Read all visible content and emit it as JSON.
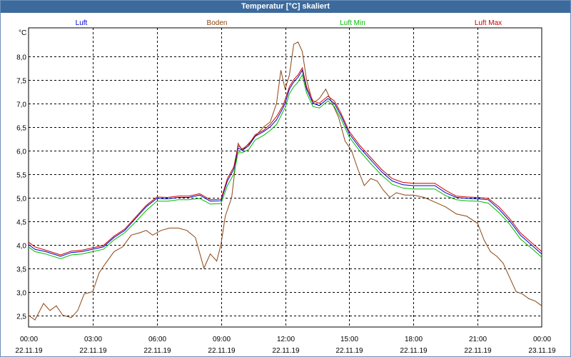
{
  "window": {
    "title": "Temperatur [°C] skaliert"
  },
  "chart_data": {
    "type": "line",
    "title": "Temperatur [°C] skaliert",
    "ylabel": "°C",
    "ylim": [
      2.25,
      8.6
    ],
    "xlim": [
      0,
      24
    ],
    "grid": true,
    "legend_position": "top",
    "y_ticks": [
      2.5,
      3.0,
      3.5,
      4.0,
      4.5,
      5.0,
      5.5,
      6.0,
      6.5,
      7.0,
      7.5,
      8.0
    ],
    "y_tick_labels": [
      "2,5",
      "3,0",
      "3,5",
      "4,0",
      "4,5",
      "5,0",
      "5,5",
      "6,0",
      "6,5",
      "7,0",
      "7,5",
      "8,0"
    ],
    "x_ticks": [
      {
        "x": 0,
        "time": "00:00",
        "date": "22.11.19"
      },
      {
        "x": 3,
        "time": "03:00",
        "date": "22.11.19"
      },
      {
        "x": 6,
        "time": "06:00",
        "date": "22.11.19"
      },
      {
        "x": 9,
        "time": "09:00",
        "date": "22.11.19"
      },
      {
        "x": 12,
        "time": "12:00",
        "date": "22.11.19"
      },
      {
        "x": 15,
        "time": "15:00",
        "date": "22.11.19"
      },
      {
        "x": 18,
        "time": "18:00",
        "date": "22.11.19"
      },
      {
        "x": 21,
        "time": "21:00",
        "date": "22.11.19"
      },
      {
        "x": 24,
        "time": "00:00",
        "date": "23.11.19"
      }
    ],
    "series": [
      {
        "name": "Luft",
        "color": "#0000cc",
        "x": [
          0,
          0.3,
          0.8,
          1.5,
          2,
          2.5,
          3,
          3.5,
          4,
          4.5,
          5,
          5.5,
          6,
          6.5,
          7,
          7.5,
          8,
          8.5,
          9,
          9.3,
          9.6,
          9.8,
          10,
          10.3,
          10.6,
          11,
          11.3,
          11.6,
          11.9,
          12,
          12.2,
          12.4,
          12.6,
          12.8,
          13,
          13.3,
          13.6,
          14,
          14.3,
          14.6,
          15,
          15.5,
          16,
          16.5,
          17,
          17.5,
          18,
          18.5,
          19,
          19.5,
          20,
          20.5,
          21,
          21.5,
          22,
          22.5,
          23,
          23.5,
          24
        ],
        "y": [
          4.0,
          3.9,
          3.85,
          3.75,
          3.83,
          3.85,
          3.9,
          3.95,
          4.15,
          4.3,
          4.55,
          4.8,
          4.98,
          4.97,
          5.0,
          5.0,
          5.05,
          4.92,
          4.93,
          5.35,
          5.6,
          6.05,
          6.0,
          6.1,
          6.3,
          6.4,
          6.5,
          6.65,
          6.9,
          7.0,
          7.3,
          7.45,
          7.55,
          7.7,
          7.3,
          7.0,
          6.95,
          7.1,
          7.0,
          6.75,
          6.35,
          6.05,
          5.8,
          5.55,
          5.35,
          5.27,
          5.25,
          5.25,
          5.25,
          5.1,
          5.0,
          4.98,
          4.97,
          4.95,
          4.75,
          4.5,
          4.2,
          4.0,
          3.8
        ]
      },
      {
        "name": "Boden",
        "color": "#8b4513",
        "x": [
          0,
          0.3,
          0.7,
          1.0,
          1.3,
          1.6,
          2,
          2.3,
          2.6,
          3.0,
          3.3,
          3.6,
          4.0,
          4.4,
          4.8,
          5.2,
          5.5,
          5.8,
          6.2,
          6.6,
          7.0,
          7.4,
          7.8,
          8.2,
          8.5,
          8.8,
          9.0,
          9.2,
          9.5,
          9.8,
          10.0,
          10.3,
          10.6,
          11.0,
          11.3,
          11.6,
          11.8,
          12.0,
          12.2,
          12.4,
          12.6,
          12.8,
          13.0,
          13.3,
          13.6,
          13.9,
          14.2,
          14.5,
          14.8,
          15.1,
          15.4,
          15.7,
          16.0,
          16.3,
          16.6,
          16.9,
          17.2,
          17.6,
          18.0,
          18.5,
          19.0,
          19.5,
          20.0,
          20.5,
          21.0,
          21.3,
          21.6,
          21.9,
          22.2,
          22.5,
          22.8,
          23.1,
          23.4,
          23.7,
          24.0
        ],
        "y": [
          2.5,
          2.4,
          2.75,
          2.6,
          2.7,
          2.5,
          2.45,
          2.6,
          2.95,
          3.0,
          3.4,
          3.6,
          3.85,
          3.95,
          4.2,
          4.25,
          4.3,
          4.2,
          4.3,
          4.35,
          4.35,
          4.3,
          4.15,
          3.5,
          3.8,
          3.65,
          4.0,
          4.6,
          5.0,
          6.15,
          6.0,
          6.15,
          6.3,
          6.5,
          6.6,
          7.0,
          7.7,
          7.3,
          7.6,
          8.25,
          8.3,
          8.1,
          7.5,
          7.0,
          7.1,
          7.3,
          7.0,
          6.7,
          6.2,
          6.0,
          5.6,
          5.25,
          5.4,
          5.35,
          5.15,
          5.0,
          5.1,
          5.05,
          5.05,
          5.0,
          4.9,
          4.8,
          4.65,
          4.6,
          4.45,
          4.1,
          3.85,
          3.75,
          3.6,
          3.3,
          3.0,
          2.95,
          2.85,
          2.8,
          2.7
        ]
      },
      {
        "name": "Luft Min",
        "color": "#00bb00",
        "x": [
          0,
          0.3,
          0.8,
          1.5,
          2,
          2.5,
          3,
          3.5,
          4,
          4.5,
          5,
          5.5,
          6,
          6.5,
          7,
          7.5,
          8,
          8.5,
          9,
          9.3,
          9.6,
          9.8,
          10,
          10.3,
          10.6,
          11,
          11.3,
          11.6,
          11.9,
          12,
          12.2,
          12.4,
          12.6,
          12.8,
          13,
          13.3,
          13.6,
          14,
          14.3,
          14.6,
          15,
          15.5,
          16,
          16.5,
          17,
          17.5,
          18,
          18.5,
          19,
          19.5,
          20,
          20.5,
          21,
          21.5,
          22,
          22.5,
          23,
          23.5,
          24
        ],
        "y": [
          3.95,
          3.85,
          3.8,
          3.7,
          3.78,
          3.8,
          3.85,
          3.9,
          4.1,
          4.25,
          4.48,
          4.72,
          4.92,
          4.92,
          4.95,
          4.95,
          4.98,
          4.86,
          4.87,
          5.25,
          5.5,
          5.95,
          5.95,
          6.02,
          6.22,
          6.32,
          6.42,
          6.55,
          6.82,
          6.9,
          7.2,
          7.35,
          7.45,
          7.6,
          7.22,
          6.93,
          6.9,
          7.05,
          6.93,
          6.68,
          6.28,
          5.98,
          5.72,
          5.48,
          5.28,
          5.2,
          5.18,
          5.18,
          5.18,
          5.04,
          4.95,
          4.93,
          4.92,
          4.88,
          4.68,
          4.43,
          4.12,
          3.93,
          3.73
        ]
      },
      {
        "name": "Luft Max",
        "color": "#cc0000",
        "x": [
          0,
          0.3,
          0.8,
          1.5,
          2,
          2.5,
          3,
          3.5,
          4,
          4.5,
          5,
          5.5,
          6,
          6.5,
          7,
          7.5,
          8,
          8.5,
          9,
          9.3,
          9.6,
          9.8,
          10,
          10.3,
          10.6,
          11,
          11.3,
          11.6,
          11.9,
          12,
          12.2,
          12.4,
          12.6,
          12.8,
          13,
          13.3,
          13.6,
          14,
          14.3,
          14.6,
          15,
          15.5,
          16,
          16.5,
          17,
          17.5,
          18,
          18.5,
          19,
          19.5,
          20,
          20.5,
          21,
          21.5,
          22,
          22.5,
          23,
          23.5,
          24
        ],
        "y": [
          4.05,
          3.95,
          3.88,
          3.78,
          3.86,
          3.88,
          3.93,
          3.98,
          4.18,
          4.33,
          4.58,
          4.83,
          5.01,
          5.0,
          5.03,
          5.03,
          5.08,
          4.95,
          4.96,
          5.4,
          5.65,
          6.1,
          6.03,
          6.13,
          6.33,
          6.43,
          6.55,
          6.72,
          6.95,
          7.08,
          7.35,
          7.5,
          7.6,
          7.75,
          7.35,
          7.05,
          7.0,
          7.15,
          7.05,
          6.8,
          6.4,
          6.1,
          5.85,
          5.6,
          5.4,
          5.32,
          5.3,
          5.3,
          5.3,
          5.15,
          5.03,
          5.01,
          5.0,
          4.98,
          4.8,
          4.55,
          4.25,
          4.05,
          3.85
        ]
      }
    ]
  }
}
